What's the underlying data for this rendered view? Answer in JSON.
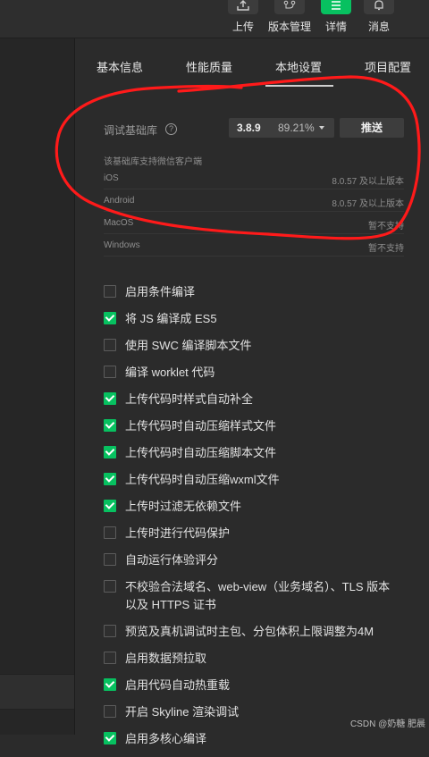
{
  "toolbar": {
    "items": [
      {
        "label": "上传",
        "icon": "upload-icon"
      },
      {
        "label": "版本管理",
        "icon": "branch-icon"
      },
      {
        "label": "详情",
        "icon": "list-icon",
        "active": true
      },
      {
        "label": "消息",
        "icon": "bell-icon"
      }
    ]
  },
  "tabs": [
    "基本信息",
    "性能质量",
    "本地设置",
    "项目配置"
  ],
  "active_tab": "本地设置",
  "library": {
    "label": "调试基础库",
    "help": "?",
    "version": "3.8.9",
    "percent": "89.21%",
    "push_label": "推送",
    "support_note": "该基础库支持微信客户端",
    "platforms": [
      {
        "name": "iOS",
        "value": "8.0.57 及以上版本"
      },
      {
        "name": "Android",
        "value": "8.0.57 及以上版本"
      },
      {
        "name": "MacOS",
        "value": "暂不支持"
      },
      {
        "name": "Windows",
        "value": "暂不支持"
      }
    ]
  },
  "options": [
    {
      "label": "启用条件编译",
      "checked": false
    },
    {
      "label": "将 JS 编译成 ES5",
      "checked": true
    },
    {
      "label": "使用 SWC 编译脚本文件",
      "checked": false
    },
    {
      "label": "编译 worklet 代码",
      "checked": false
    },
    {
      "label": "上传代码时样式自动补全",
      "checked": true
    },
    {
      "label": "上传代码时自动压缩样式文件",
      "checked": true
    },
    {
      "label": "上传代码时自动压缩脚本文件",
      "checked": true
    },
    {
      "label": "上传代码时自动压缩wxml文件",
      "checked": true
    },
    {
      "label": "上传时过滤无依赖文件",
      "checked": true
    },
    {
      "label": "上传时进行代码保护",
      "checked": false
    },
    {
      "label": "自动运行体验评分",
      "checked": false
    },
    {
      "label": "不校验合法域名、web-view（业务域名）、TLS 版本以及 HTTPS 证书",
      "checked": false
    },
    {
      "label": "预览及真机调试时主包、分包体积上限调整为4M",
      "checked": false
    },
    {
      "label": "启用数据预拉取",
      "checked": false
    },
    {
      "label": "启用代码自动热重载",
      "checked": true
    },
    {
      "label": "开启 Skyline 渲染调试",
      "checked": false
    },
    {
      "label": "启用多核心编译",
      "checked": true
    }
  ],
  "watermark": "CSDN @奶糖 肥晨",
  "colors": {
    "accent": "#07c160",
    "annotation": "#ff1a1a"
  }
}
